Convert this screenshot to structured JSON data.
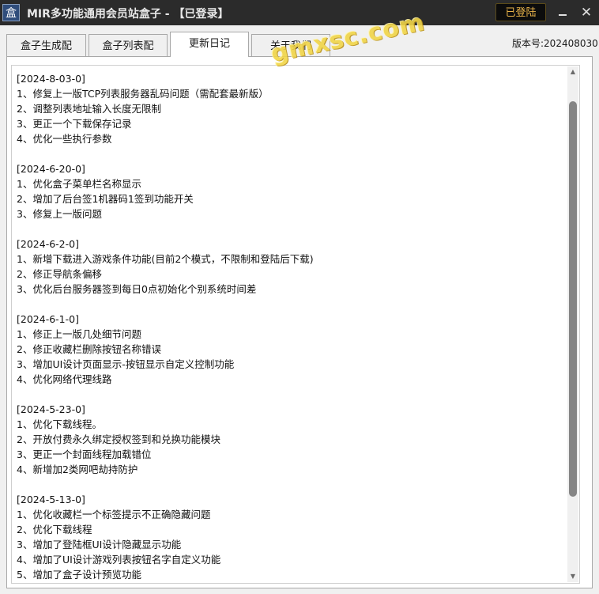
{
  "window": {
    "title": "MIR多功能通用会员站盒子 - 【已登录】",
    "app_icon_glyph": "盒",
    "login_label": "已登陆",
    "minimize_icon": "minimize-icon",
    "close_glyph": "✕"
  },
  "version": "版本号:202408030",
  "tabs": [
    {
      "label": "盒子生成配"
    },
    {
      "label": "盒子列表配"
    },
    {
      "label": "更新日记"
    },
    {
      "label": "关于我们"
    }
  ],
  "active_tab": 2,
  "watermark": "gmxsc.com",
  "changelog": [
    {
      "header": "[2024-8-03-0]",
      "items": [
        "1、修复上一版TCP列表服务器乱码问题（需配套最新版）",
        "2、调整列表地址输入长度无限制",
        "3、更正一个下载保存记录",
        "4、优化一些执行参数"
      ]
    },
    {
      "header": "[2024-6-20-0]",
      "items": [
        "1、优化盒子菜单栏名称显示",
        "2、增加了后台签1机器码1签到功能开关",
        "3、修复上一版问题"
      ]
    },
    {
      "header": "[2024-6-2-0]",
      "items": [
        "1、新增下载进入游戏条件功能(目前2个模式，不限制和登陆后下载)",
        "2、修正导航条偏移",
        "3、优化后台服务器签到每日0点初始化个别系统时间差"
      ]
    },
    {
      "header": "[2024-6-1-0]",
      "items": [
        "1、修正上一版几处细节问题",
        "2、修正收藏栏删除按钮名称错误",
        "3、增加UI设计页面显示-按钮显示自定义控制功能",
        "4、优化网络代理线路"
      ]
    },
    {
      "header": "[2024-5-23-0]",
      "items": [
        "1、优化下载线程。",
        "2、开放付费永久绑定授权签到和兑换功能模块",
        "3、更正一个封面线程加载错位",
        "4、新增加2类网吧劫持防护"
      ]
    },
    {
      "header": "[2024-5-13-0]",
      "items": [
        "1、优化收藏栏一个标签提示不正确隐藏问题",
        "2、优化下载线程",
        "3、增加了登陆框UI设计隐藏显示功能",
        "4、增加了UI设计游戏列表按钮名字自定义功能",
        "5、增加了盒子设计预览功能"
      ]
    }
  ]
}
